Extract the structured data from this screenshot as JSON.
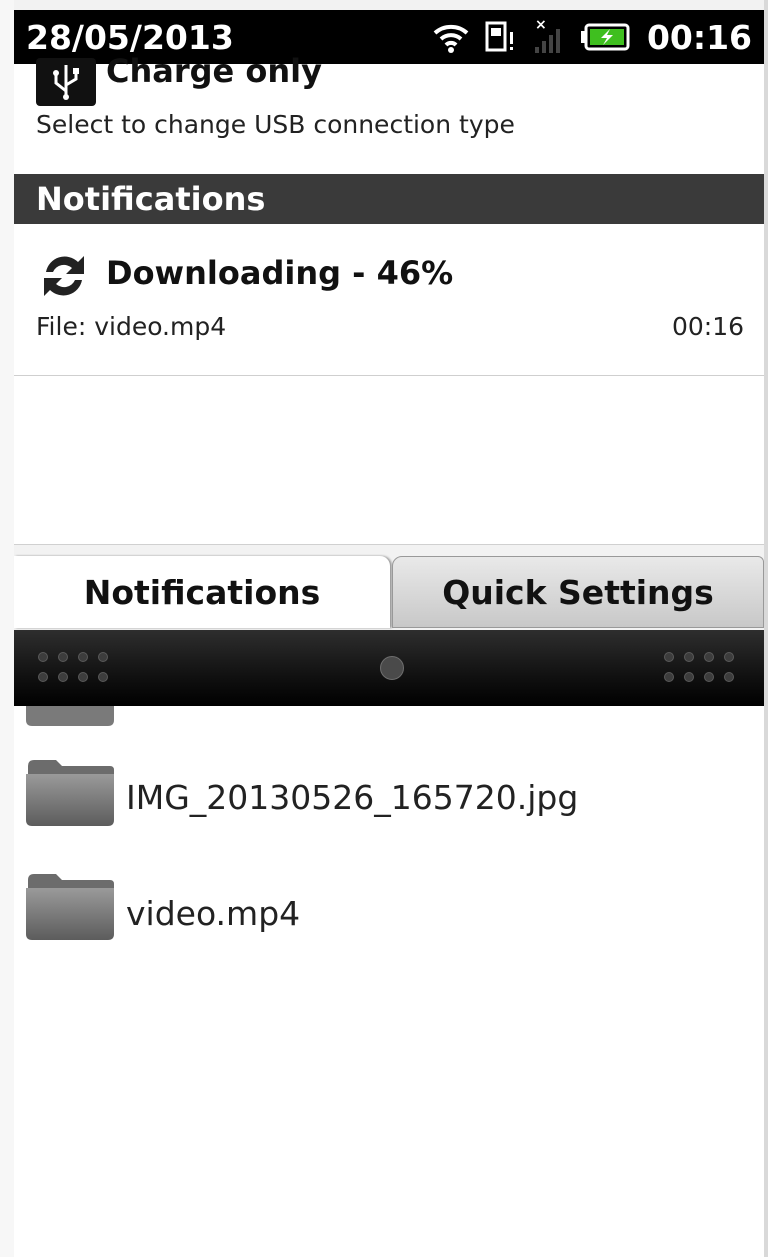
{
  "status_bar": {
    "date": "28/05/2013",
    "time": "00:16",
    "icons": [
      "wifi-icon",
      "sd-card-alert-icon",
      "no-signal-icon",
      "battery-charging-icon"
    ]
  },
  "usb": {
    "title": "Charge only",
    "subtitle": "Select to change USB connection type"
  },
  "notifications_header": "Notifications",
  "notification": {
    "title": "Downloading - 46%",
    "file": "File: video.mp4",
    "time": "00:16",
    "progress_percent": 46
  },
  "tabs": [
    {
      "label": "Notifications",
      "active": true
    },
    {
      "label": "Quick Settings",
      "active": false
    }
  ],
  "files": [
    {
      "name": "IMG_20130526_165720.jpg"
    },
    {
      "name": "video.mp4"
    }
  ],
  "colors": {
    "status_bar": "#000000",
    "section_header": "#3a3a3a",
    "battery_green": "#3fbf1f"
  }
}
